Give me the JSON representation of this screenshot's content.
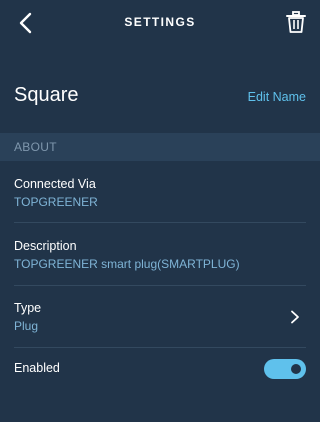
{
  "header": {
    "title": "SETTINGS",
    "back_icon": "chevron-left-icon",
    "delete_icon": "trash-icon"
  },
  "device": {
    "name": "Square",
    "edit_label": "Edit Name"
  },
  "about": {
    "section_title": "ABOUT",
    "connected_via": {
      "label": "Connected Via",
      "value": "TOPGREENER"
    },
    "description": {
      "label": "Description",
      "value": "TOPGREENER smart plug(SMARTPLUG)"
    },
    "type": {
      "label": "Type",
      "value": "Plug"
    },
    "enabled": {
      "label": "Enabled",
      "state": true
    }
  },
  "colors": {
    "background": "#213449",
    "section_band": "#2a4159",
    "accent": "#5fc1ec",
    "value_text": "#7fb4d6"
  }
}
